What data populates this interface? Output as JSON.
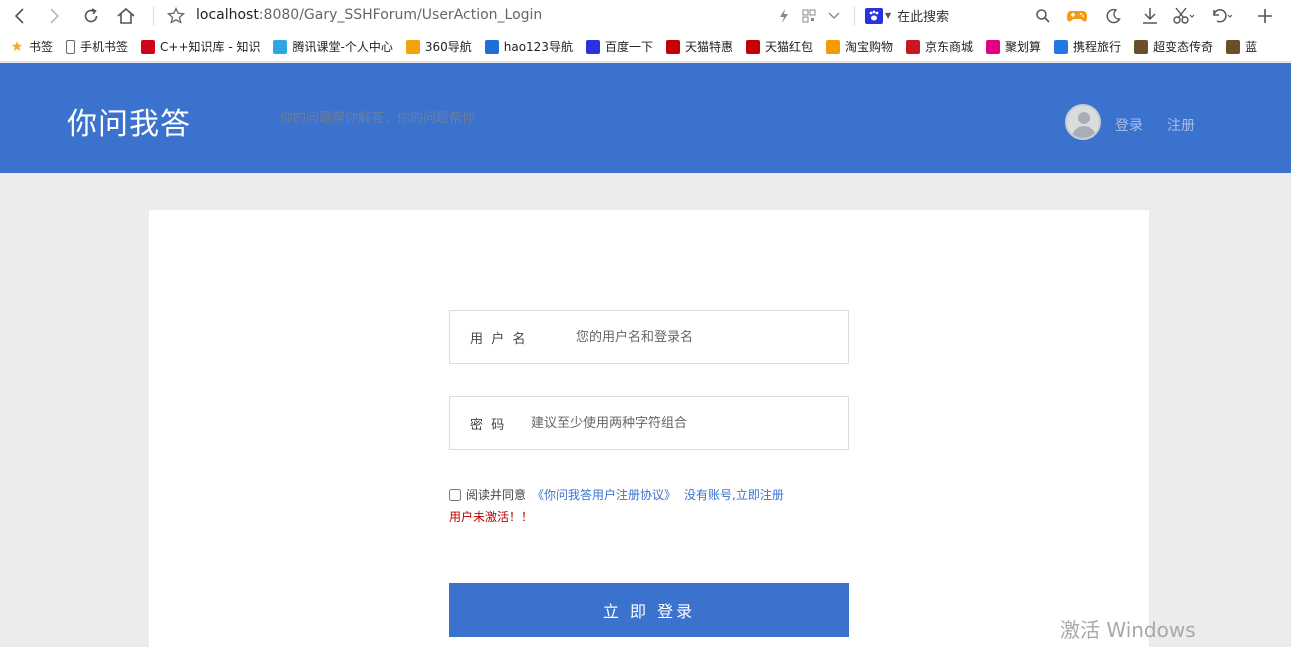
{
  "browser": {
    "address_host": "localhost",
    "address_path": ":8080/Gary_SSHForum/UserAction_Login",
    "search_engine_label": "在此搜索"
  },
  "bookmarks": [
    {
      "label": "书签",
      "icon": "star-icon",
      "color": "#f5a623"
    },
    {
      "label": "手机书签",
      "icon": "mobile-icon",
      "color": "#666666"
    },
    {
      "label": "C++知识库 - 知识",
      "icon": "c-icon",
      "color": "#d0021b"
    },
    {
      "label": "腾讯课堂-个人中心",
      "icon": "tencent-icon",
      "color": "#2ea7e0"
    },
    {
      "label": "360导航",
      "icon": "360-icon",
      "color": "#f0a30a"
    },
    {
      "label": "hao123导航",
      "icon": "hao123-icon",
      "color": "#1e6fd9"
    },
    {
      "label": "百度一下",
      "icon": "baidu-icon",
      "color": "#2932e1"
    },
    {
      "label": "天猫特惠",
      "icon": "tmall-icon",
      "color": "#c40000"
    },
    {
      "label": "天猫红包",
      "icon": "tmall-icon",
      "color": "#c40000"
    },
    {
      "label": "淘宝购物",
      "icon": "taobao-icon",
      "color": "#f59b00"
    },
    {
      "label": "京东商城",
      "icon": "jd-icon",
      "color": "#c91623"
    },
    {
      "label": "聚划算",
      "icon": "juhuasuan-icon",
      "color": "#e4007f"
    },
    {
      "label": "携程旅行",
      "icon": "ctrip-icon",
      "color": "#2577e3"
    },
    {
      "label": "超变态传奇",
      "icon": "game-icon",
      "color": "#6b4f2a"
    },
    {
      "label": "蓝",
      "icon": "game-icon",
      "color": "#6b4f2a"
    }
  ],
  "header": {
    "logo": "你问我答",
    "slogan": "你的问题帮你解答，你的问题帮你",
    "login_label": "登录",
    "register_label": "注册"
  },
  "form": {
    "username_label": "用  户  名",
    "username_placeholder": "您的用户名和登录名",
    "password_label": "密  码",
    "password_placeholder": "建议至少使用两种字符组合",
    "agree_text": "阅读并同意",
    "agreement_link": "《你问我答用户注册协议》",
    "register_link": "没有账号,立即注册",
    "error_message": "用户未激活！！",
    "submit_label": "立 即 登录"
  },
  "system": {
    "watermark": "激活 Windows"
  },
  "colors": {
    "brand": "#3a72ce",
    "error": "#c00000"
  }
}
